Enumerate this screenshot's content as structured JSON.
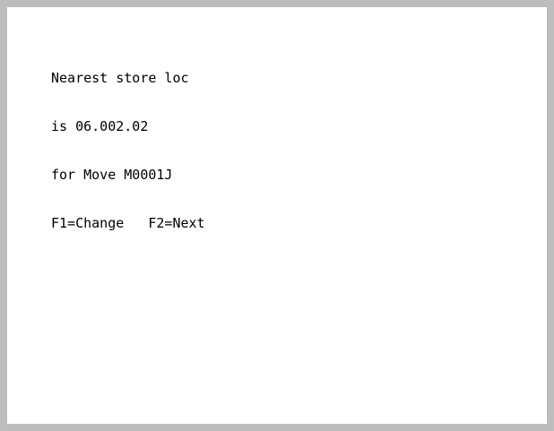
{
  "screen": {
    "lines": [
      "Nearest store loc",
      "is 06.002.02",
      "for Move M0001J",
      "F1=Change   F2=Next"
    ]
  },
  "colors": {
    "frame": "#bdbdbd",
    "screen_background": "#ffffff",
    "text": "#000000"
  }
}
